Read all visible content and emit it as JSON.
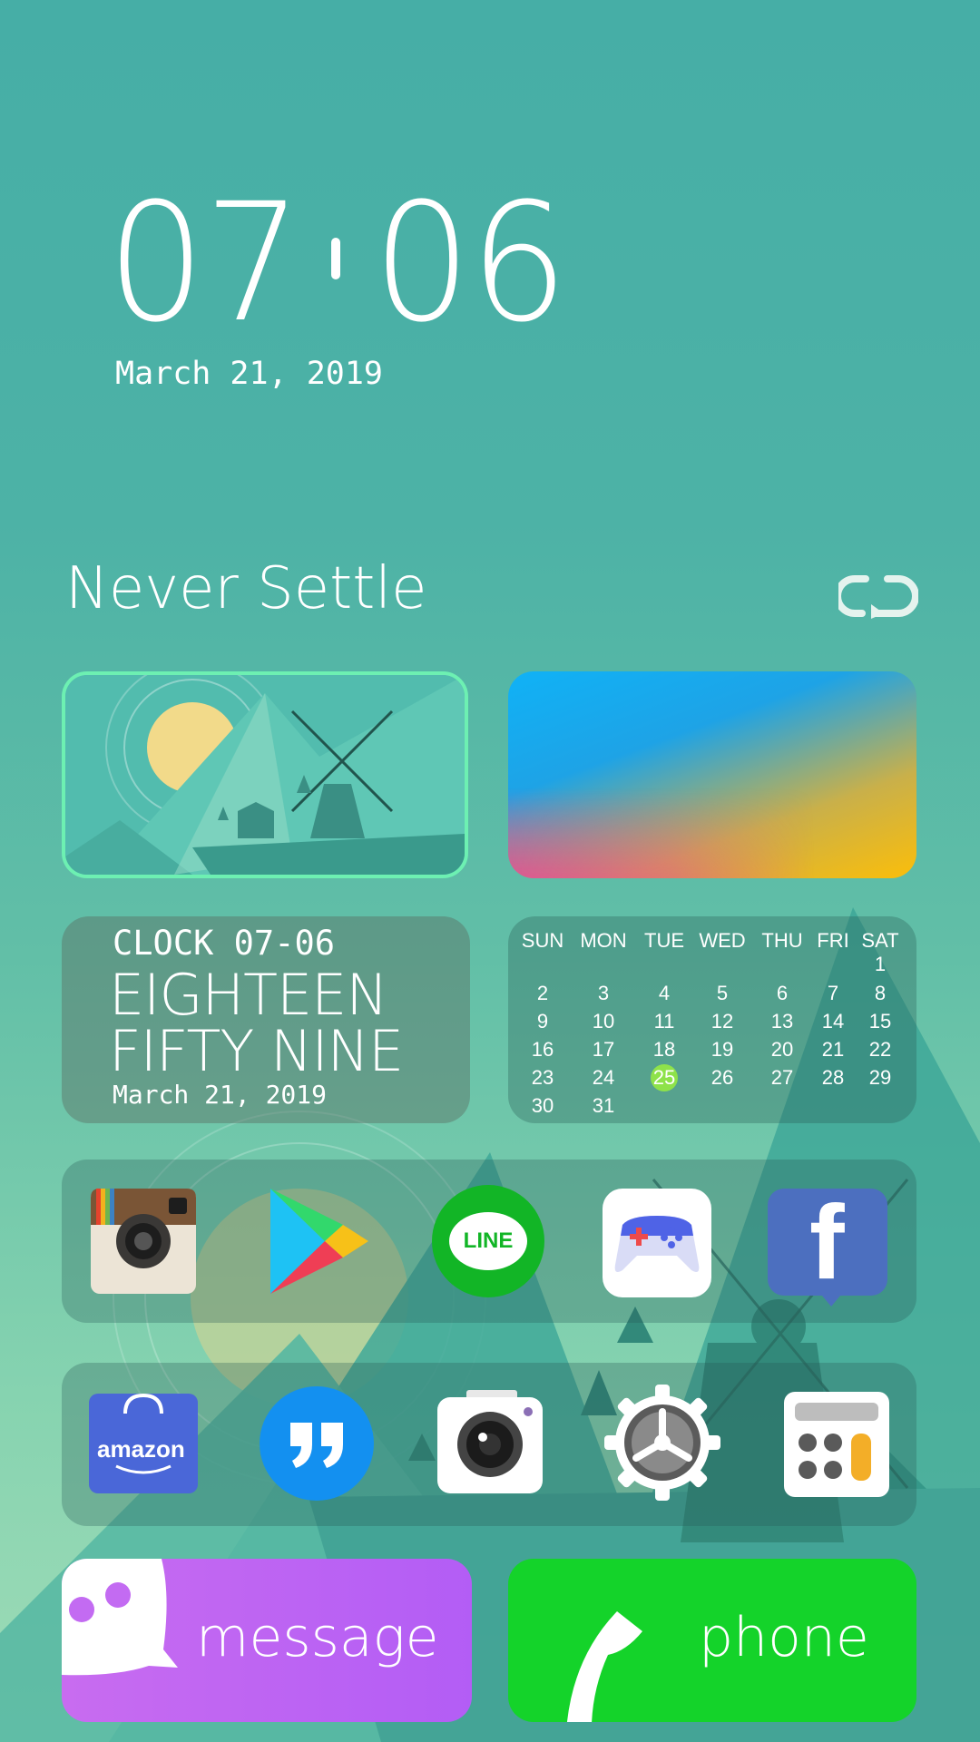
{
  "clock": {
    "hours": "07",
    "minutes": "06",
    "date": "March 21, 2019"
  },
  "motto": {
    "text": "Never Settle"
  },
  "clock_widget": {
    "label": "CLOCK 07-06",
    "words_line1": "EIGHTEEN",
    "words_line2": "FIFTY NINE",
    "date": "March 21, 2019"
  },
  "calendar": {
    "days": [
      "SUN",
      "MON",
      "TUE",
      "WED",
      "THU",
      "FRI",
      "SAT"
    ],
    "weeks": [
      [
        "",
        "",
        "",
        "",
        "",
        "",
        "1"
      ],
      [
        "2",
        "3",
        "4",
        "5",
        "6",
        "7",
        "8"
      ],
      [
        "9",
        "10",
        "11",
        "12",
        "13",
        "14",
        "15"
      ],
      [
        "16",
        "17",
        "18",
        "19",
        "20",
        "21",
        "22"
      ],
      [
        "23",
        "24",
        "25",
        "26",
        "27",
        "28",
        "29"
      ],
      [
        "30",
        "31",
        "",
        "",
        "",
        "",
        ""
      ]
    ],
    "highlighted_day": "25",
    "highlight_color": "#8ee24a"
  },
  "dock_row1": [
    {
      "name": "Instagram",
      "icon": "instagram-icon"
    },
    {
      "name": "Play Store",
      "icon": "play-store-icon"
    },
    {
      "name": "LINE",
      "icon": "line-icon",
      "text": "LINE"
    },
    {
      "name": "Game Center",
      "icon": "gamepad-icon"
    },
    {
      "name": "Facebook",
      "icon": "facebook-icon",
      "text": "f"
    }
  ],
  "dock_row2": [
    {
      "name": "Amazon",
      "icon": "amazon-icon",
      "text": "amazon"
    },
    {
      "name": "Quotes",
      "icon": "quote-icon",
      "text": "99"
    },
    {
      "name": "Camera",
      "icon": "camera-icon"
    },
    {
      "name": "Settings",
      "icon": "gear-icon"
    },
    {
      "name": "Calculator",
      "icon": "calculator-icon"
    }
  ],
  "buttons": {
    "message": "message",
    "phone": "phone"
  },
  "colors": {
    "background": "#4db2a6",
    "message_button": "#c16af2",
    "phone_button": "#14d32a",
    "photo_border": "#6df0b2"
  }
}
